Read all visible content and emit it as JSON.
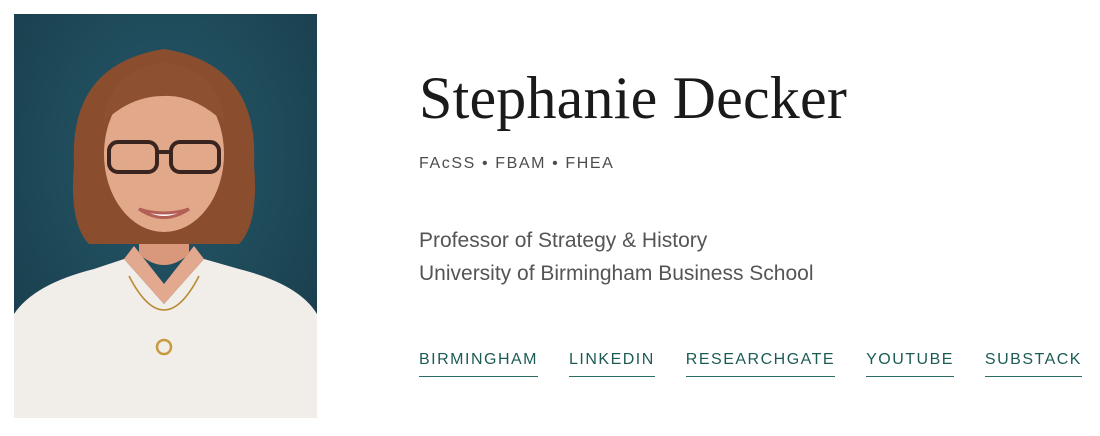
{
  "profile": {
    "name": "Stephanie Decker",
    "credentials": "FAcSS • FBAM • FHEA",
    "title": "Professor of Strategy & History",
    "institution": "University of Birmingham Business School"
  },
  "links": [
    {
      "label": "BIRMINGHAM"
    },
    {
      "label": "LINKEDIN"
    },
    {
      "label": "RESEARCHGATE"
    },
    {
      "label": "YOUTUBE"
    },
    {
      "label": "SUBSTACK"
    }
  ],
  "colors": {
    "link": "#1c5b55",
    "photo_background": "#1f4c5b"
  }
}
